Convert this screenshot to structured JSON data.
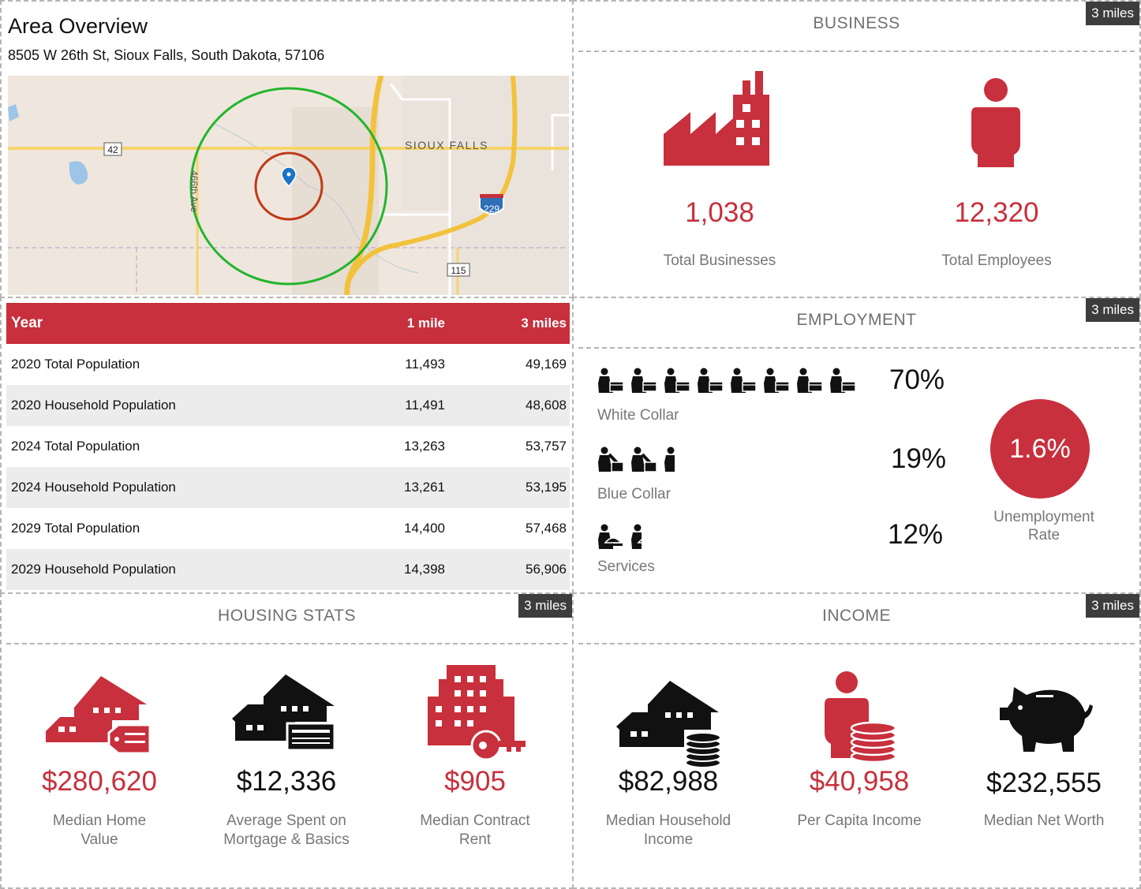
{
  "overview": {
    "title": "Area Overview",
    "address": "8505 W 26th St, Sioux Falls, South Dakota, 57106",
    "map": {
      "city_label": "SIOUX FALLS",
      "road_label": "466th Ave",
      "route_42": "42",
      "route_115": "115",
      "interstate_229": "229"
    }
  },
  "table": {
    "headers": [
      "Year",
      "1 mile",
      "3 miles"
    ],
    "rows": [
      [
        "2020 Total Population",
        "11,493",
        "49,169"
      ],
      [
        "2020 Household Population",
        "11,491",
        "48,608"
      ],
      [
        "2024 Total Population",
        "13,263",
        "53,757"
      ],
      [
        "2024 Household Population",
        "13,261",
        "53,195"
      ],
      [
        "2029 Total Population",
        "14,400",
        "57,468"
      ],
      [
        "2029 Household Population",
        "14,398",
        "56,906"
      ]
    ]
  },
  "business": {
    "title": "BUSINESS",
    "badge": "3 miles",
    "total_businesses": {
      "value": "1,038",
      "label": "Total Businesses"
    },
    "total_employees": {
      "value": "12,320",
      "label": "Total Employees"
    }
  },
  "employment": {
    "title": "EMPLOYMENT",
    "badge": "3 miles",
    "white_collar": {
      "pct": "70%",
      "label": "White Collar",
      "icon_count": 8
    },
    "blue_collar": {
      "pct": "19%",
      "label": "Blue Collar",
      "icon_count": 2.5
    },
    "services": {
      "pct": "12%",
      "label": "Services",
      "icon_count": 1.5
    },
    "unemployment": {
      "value": "1.6%",
      "label_line1": "Unemployment",
      "label_line2": "Rate"
    }
  },
  "housing": {
    "title": "HOUSING STATS",
    "badge": "3 miles",
    "home_value": {
      "value": "$280,620",
      "line1": "Median Home",
      "line2": "Value"
    },
    "mortgage": {
      "value": "$12,336",
      "line1": "Average Spent on",
      "line2": "Mortgage & Basics"
    },
    "rent": {
      "value": "$905",
      "line1": "Median Contract",
      "line2": "Rent"
    }
  },
  "income": {
    "title": "INCOME",
    "badge": "3 miles",
    "household": {
      "value": "$82,988",
      "line1": "Median Household",
      "line2": "Income"
    },
    "per_capita": {
      "value": "$40,958",
      "line1": "Per Capita Income",
      "line2": ""
    },
    "net_worth": {
      "value": "$232,555",
      "line1": "Median Net Worth",
      "line2": ""
    }
  },
  "colors": {
    "accent": "#c7303c",
    "badge": "#3d3d3d",
    "dark": "#111111"
  }
}
